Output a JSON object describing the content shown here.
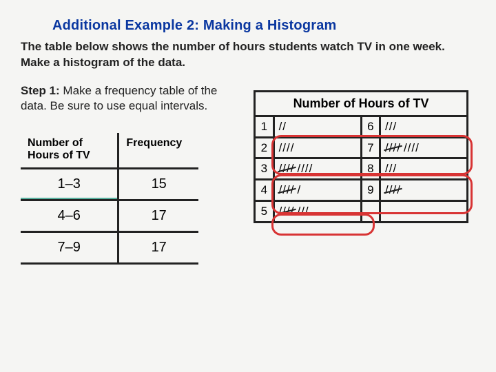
{
  "title": "Additional Example 2: Making a Histogram",
  "subtitle": "The table below shows the number of hours students watch TV in one week. Make a histogram of the data.",
  "step": {
    "label": "Step 1:",
    "text": " Make a frequency table of the data. Be sure to use equal intervals."
  },
  "freq_table": {
    "headers": [
      "Number of Hours of TV",
      "Frequency"
    ],
    "rows": [
      {
        "interval": "1–3",
        "freq": "15"
      },
      {
        "interval": "4–6",
        "freq": "17"
      },
      {
        "interval": "7–9",
        "freq": "17"
      }
    ]
  },
  "tally_table": {
    "title": "Number of Hours of TV",
    "left": [
      {
        "n": "1",
        "count": 2
      },
      {
        "n": "2",
        "count": 4
      },
      {
        "n": "3",
        "count": 9
      },
      {
        "n": "4",
        "count": 6
      },
      {
        "n": "5",
        "count": 8
      }
    ],
    "right": [
      {
        "n": "6",
        "count": 3
      },
      {
        "n": "7",
        "count": 9
      },
      {
        "n": "8",
        "count": 3
      },
      {
        "n": "9",
        "count": 5
      },
      {
        "n": "",
        "count": 0
      }
    ]
  },
  "chart_data": {
    "type": "table",
    "title": "Frequency table derived from tally (hours of TV per week)",
    "raw_tally": {
      "1": 2,
      "2": 4,
      "3": 9,
      "4": 6,
      "5": 8,
      "6": 3,
      "7": 9,
      "8": 3,
      "9": 5
    },
    "frequency": {
      "categories": [
        "1–3",
        "4–6",
        "7–9"
      ],
      "values": [
        15,
        17,
        17
      ]
    },
    "xlabel": "Number of Hours of TV",
    "ylabel": "Frequency"
  }
}
